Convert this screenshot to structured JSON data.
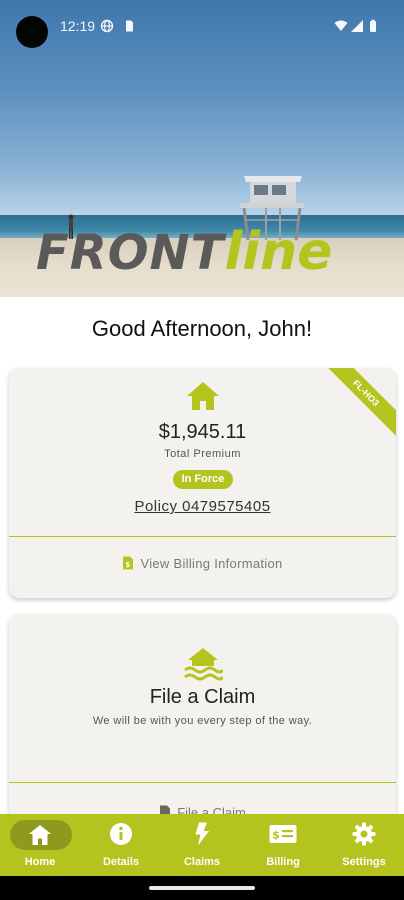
{
  "status_bar": {
    "time": "12:19"
  },
  "brand": {
    "front": "FRONT",
    "line": "line"
  },
  "greeting": "Good Afternoon, John!",
  "policy_card": {
    "ribbon": "FL-HO3",
    "premium": "$1,945.11",
    "premium_label": "Total Premium",
    "status_badge": "In Force",
    "policy_number": "Policy 0479575405",
    "billing_link": "View Billing Information"
  },
  "claim_card": {
    "title": "File a Claim",
    "subtitle": "We will be with you every step of the way.",
    "action_link": "File a Claim"
  },
  "bottom_nav": {
    "items": [
      {
        "label": "Home",
        "icon": "home-icon",
        "active": true
      },
      {
        "label": "Details",
        "icon": "info-icon",
        "active": false
      },
      {
        "label": "Claims",
        "icon": "lightning-icon",
        "active": false
      },
      {
        "label": "Billing",
        "icon": "bill-icon",
        "active": false
      },
      {
        "label": "Settings",
        "icon": "gear-icon",
        "active": false
      }
    ]
  },
  "colors": {
    "accent": "#b5c31f",
    "accent_dark": "#8d9a1e",
    "card_bg": "#f3f2ee",
    "logo_gray": "#5a5a5a"
  }
}
